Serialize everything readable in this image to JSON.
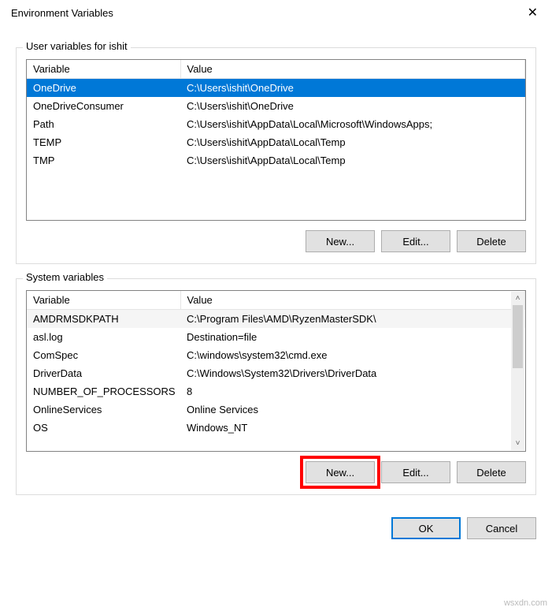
{
  "window": {
    "title": "Environment Variables",
    "close_glyph": "✕"
  },
  "user_section": {
    "label": "User variables for ishit",
    "headers": {
      "variable": "Variable",
      "value": "Value"
    },
    "rows": [
      {
        "name": "OneDrive",
        "value": "C:\\Users\\ishit\\OneDrive",
        "selected": true
      },
      {
        "name": "OneDriveConsumer",
        "value": "C:\\Users\\ishit\\OneDrive"
      },
      {
        "name": "Path",
        "value": "C:\\Users\\ishit\\AppData\\Local\\Microsoft\\WindowsApps;"
      },
      {
        "name": "TEMP",
        "value": "C:\\Users\\ishit\\AppData\\Local\\Temp"
      },
      {
        "name": "TMP",
        "value": "C:\\Users\\ishit\\AppData\\Local\\Temp"
      }
    ],
    "buttons": {
      "new": "New...",
      "edit": "Edit...",
      "delete": "Delete"
    }
  },
  "system_section": {
    "label": "System variables",
    "headers": {
      "variable": "Variable",
      "value": "Value"
    },
    "rows": [
      {
        "name": "AMDRMSDKPATH",
        "value": "C:\\Program Files\\AMD\\RyzenMasterSDK\\",
        "alt": true
      },
      {
        "name": "asl.log",
        "value": "Destination=file"
      },
      {
        "name": "ComSpec",
        "value": "C:\\windows\\system32\\cmd.exe"
      },
      {
        "name": "DriverData",
        "value": "C:\\Windows\\System32\\Drivers\\DriverData"
      },
      {
        "name": "NUMBER_OF_PROCESSORS",
        "value": "8"
      },
      {
        "name": "OnlineServices",
        "value": "Online Services"
      },
      {
        "name": "OS",
        "value": "Windows_NT"
      }
    ],
    "buttons": {
      "new": "New...",
      "edit": "Edit...",
      "delete": "Delete"
    }
  },
  "footer": {
    "ok": "OK",
    "cancel": "Cancel"
  },
  "watermark": "wsxdn.com"
}
